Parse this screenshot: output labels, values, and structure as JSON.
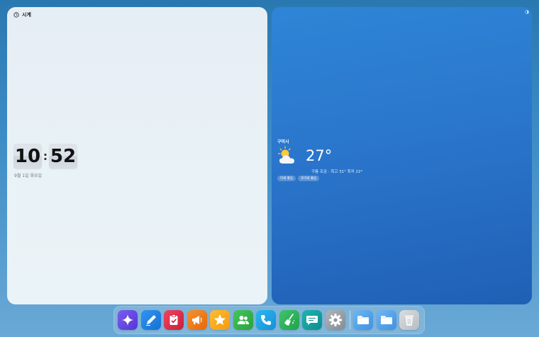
{
  "clock_widget": {
    "title": "시계",
    "hours": "10",
    "minutes": "52",
    "separator": ":",
    "date": "9월 1일 화요일"
  },
  "weather_widget": {
    "city": "구미시",
    "temperature": "27°",
    "description": "구름 조금 · 최고 31° 최저 22°",
    "badges": [
      "미세 좋음",
      "초미세 좋음"
    ],
    "icon": "partly-cloudy-icon"
  },
  "dock": {
    "apps": [
      {
        "name": "assistant",
        "icon": "sparkle-icon",
        "color": "#6d4ee8"
      },
      {
        "name": "notes",
        "icon": "pen-icon",
        "color": "#1f86e6"
      },
      {
        "name": "tasks",
        "icon": "clipboard-check-icon",
        "color": "#e0304e"
      },
      {
        "name": "announcements",
        "icon": "megaphone-icon",
        "color": "#f07a1d"
      },
      {
        "name": "favorites",
        "icon": "star-icon",
        "color": "#f5a623"
      },
      {
        "name": "contacts",
        "icon": "people-icon",
        "color": "#34b54a"
      },
      {
        "name": "phone",
        "icon": "phone-icon",
        "color": "#1ca7e8"
      },
      {
        "name": "cleaner",
        "icon": "broom-icon",
        "color": "#2fb55d"
      },
      {
        "name": "messages",
        "icon": "chat-icon",
        "color": "#16a2a0"
      },
      {
        "name": "settings",
        "icon": "gear-icon",
        "color": "#9aa1a8"
      },
      {
        "name": "folder-1",
        "icon": "folder-icon",
        "color": "#5aa8ef"
      },
      {
        "name": "folder-2",
        "icon": "folder-icon",
        "color": "#5aa8ef"
      },
      {
        "name": "trash",
        "icon": "trash-icon",
        "color": "#c9cdd1"
      }
    ]
  }
}
